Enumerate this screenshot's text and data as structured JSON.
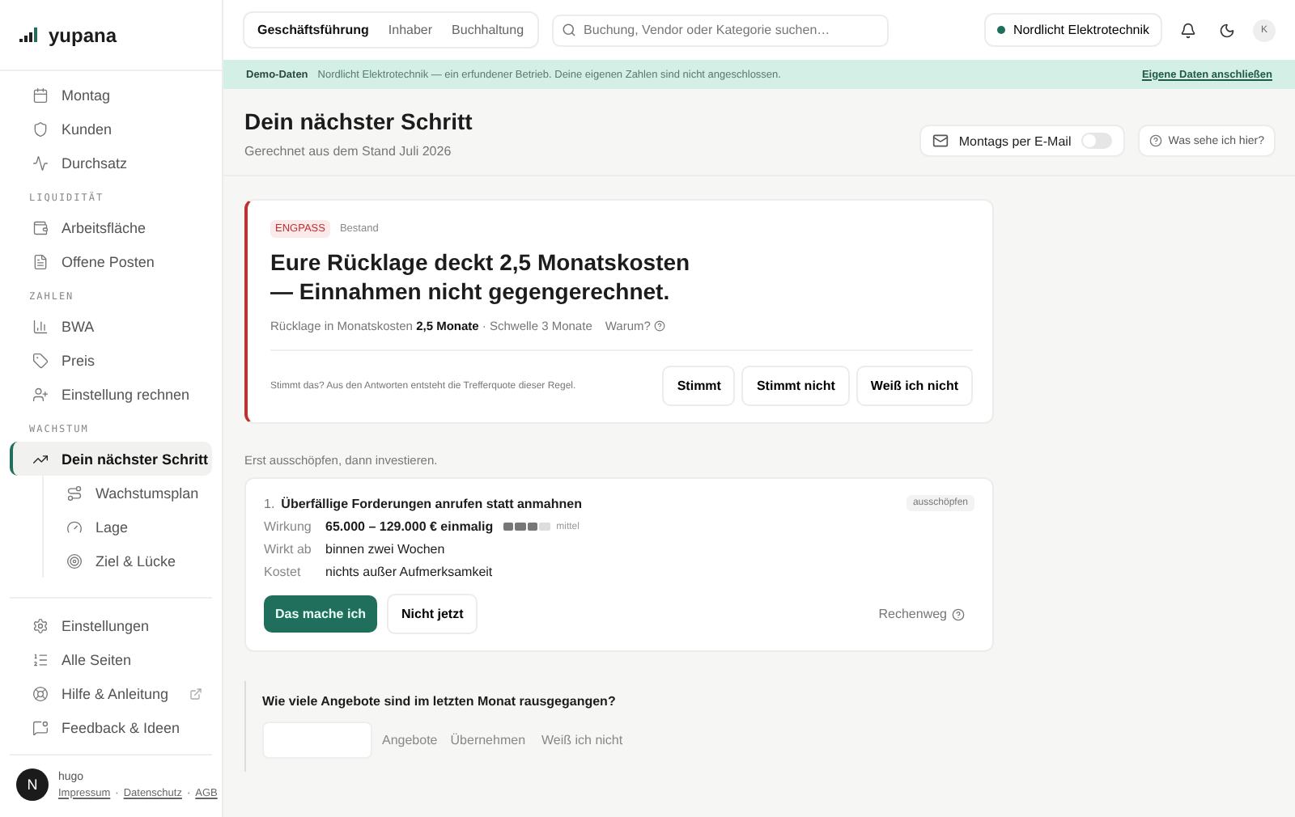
{
  "brand": {
    "name": "yupana"
  },
  "sidebar": {
    "sections": [
      {
        "items": [
          {
            "label": "Montag",
            "selected": false
          },
          {
            "label": "Kunden",
            "selected": false
          },
          {
            "label": "Durchsatz",
            "selected": false
          }
        ]
      },
      {
        "heading": "LIQUIDITÄT",
        "items": [
          {
            "label": "Arbeitsfläche",
            "selected": false
          },
          {
            "label": "Offene Posten",
            "selected": false
          }
        ]
      },
      {
        "heading": "ZAHLEN",
        "items": [
          {
            "label": "BWA",
            "selected": false
          },
          {
            "label": "Preis",
            "selected": false
          },
          {
            "label": "Einstellung rechnen",
            "selected": false
          }
        ]
      },
      {
        "heading": "WACHSTUM",
        "items": [
          {
            "label": "Dein nächster Schritt",
            "selected": true,
            "children": [
              {
                "label": "Wachstumsplan",
                "selected": false
              },
              {
                "label": "Lage",
                "selected": false
              },
              {
                "label": "Ziel & Lücke",
                "selected": false
              }
            ]
          }
        ]
      }
    ],
    "bottom_items": [
      {
        "label": "Einstellungen",
        "external": false
      },
      {
        "label": "Alle Seiten",
        "external": false
      },
      {
        "label": "Hilfe & Anleitung",
        "external": true
      },
      {
        "label": "Feedback & Ideen",
        "external": false
      }
    ],
    "footer": {
      "avatar": "N",
      "user": "hugo",
      "links": [
        "Impressum",
        "Datenschutz",
        "AGB"
      ],
      "separator": "·"
    }
  },
  "topbar": {
    "tabs": [
      {
        "label": "Geschäftsführung",
        "selected": true
      },
      {
        "label": "Inhaber",
        "selected": false
      },
      {
        "label": "Buchhaltung",
        "selected": false
      }
    ],
    "search": {
      "placeholder": "Buchung, Vendor oder Kategorie suchen…"
    },
    "company": {
      "name": "Nordlicht Elektrotechnik",
      "color": "#1f6f5c"
    },
    "avatar": "K"
  },
  "banner": {
    "label": "Demo-Daten",
    "text": "Nordlicht Elektrotechnik — ein erfundener Betrieb. Deine eigenen Zahlen sind nicht angeschlossen.",
    "link": "Eigene Daten anschließen"
  },
  "header": {
    "title": "Dein nächster Schritt",
    "subtitle": "Gerechnet aus dem Stand Juli 2026",
    "email_toggle": {
      "label": "Montags per E-Mail",
      "on": false
    },
    "help": "Was sehe ich hier?"
  },
  "alert": {
    "tag": "ENGPASS",
    "category": "Bestand",
    "headline": "Eure Rücklage deckt 2,5 Monatskosten — Einnahmen nicht gegengerechnet.",
    "metric": "Rücklage in Monatskosten **2,5 Monate** · Schwelle 3 Monate",
    "why": "Warum?",
    "question": "Stimmt das? Aus den Antworten entsteht die Trefferquote dieser Regel.",
    "buttons": [
      "Stimmt",
      "Stimmt nicht",
      "Weiß ich nicht"
    ]
  },
  "intro": "Erst ausschöpfen, dann investieren.",
  "steps": [
    {
      "number": "1.",
      "title": "Überfällige Forderungen anrufen statt anmahnen",
      "badge": "ausschöpfen",
      "facts": [
        {
          "label": "Wirkung",
          "value": "65.000 – 129.000 € einmalig",
          "meter": {
            "level": 0.75,
            "label": "mittel"
          }
        },
        {
          "label": "Wirkt ab",
          "value": "binnen zwei Wochen"
        },
        {
          "label": "Kostet",
          "value": "nichts außer Aufmerksamkeit"
        }
      ],
      "primary": "Das mache ich",
      "secondary": "Nicht jetzt",
      "link": "Rechenweg"
    }
  ],
  "question": {
    "text": "Wie viele Angebote sind im letzten Monat rausgegangen?",
    "unit": "Angebote",
    "apply": "Übernehmen",
    "unknown": "Weiß ich nicht"
  }
}
